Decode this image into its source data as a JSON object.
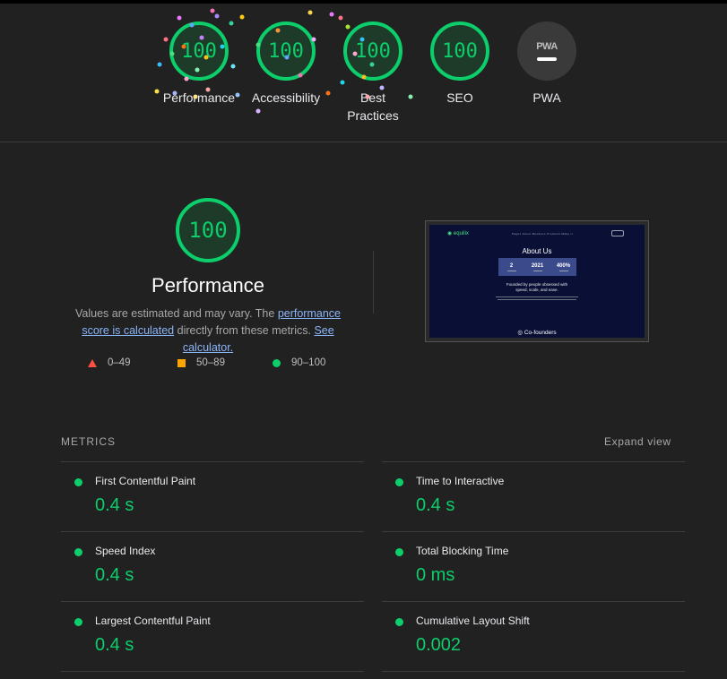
{
  "gauges": [
    {
      "score": "100",
      "label": "Performance"
    },
    {
      "score": "100",
      "label": "Accessibility"
    },
    {
      "score": "100",
      "label": "Best Practices"
    },
    {
      "score": "100",
      "label": "SEO"
    },
    {
      "badge": "PWA",
      "label": "PWA"
    }
  ],
  "performance": {
    "score": "100",
    "title": "Performance",
    "desc_before": "Values are estimated and may vary. The ",
    "link_score": "performance score is calculated",
    "desc_mid": " directly from these metrics. ",
    "link_calc": "See calculator.",
    "legend": {
      "fail": "0–49",
      "average": "50–89",
      "pass": "90–100"
    }
  },
  "screenshot": {
    "logo": "◉ equilix",
    "nav": "Pages  About  Members  Products  Make it",
    "title": "About Us",
    "stats": [
      "2",
      "2021",
      "400%"
    ],
    "tagline_1": "Founded by people obsessed with",
    "tagline_2": "speed, scale, and ease.",
    "cofounders": "◎ Co-founders"
  },
  "metrics_section": {
    "title": "METRICS",
    "expand": "Expand view"
  },
  "metrics": [
    {
      "name": "First Contentful Paint",
      "value": "0.4 s"
    },
    {
      "name": "Time to Interactive",
      "value": "0.4 s"
    },
    {
      "name": "Speed Index",
      "value": "0.4 s"
    },
    {
      "name": "Total Blocking Time",
      "value": "0 ms"
    },
    {
      "name": "Largest Contentful Paint",
      "value": "0.4 s"
    },
    {
      "name": "Cumulative Layout Shift",
      "value": "0.002"
    }
  ],
  "colors": {
    "pass": "#0cce6b",
    "average": "#ffa400",
    "fail": "#ff4e42",
    "link": "#8ab4f8"
  }
}
